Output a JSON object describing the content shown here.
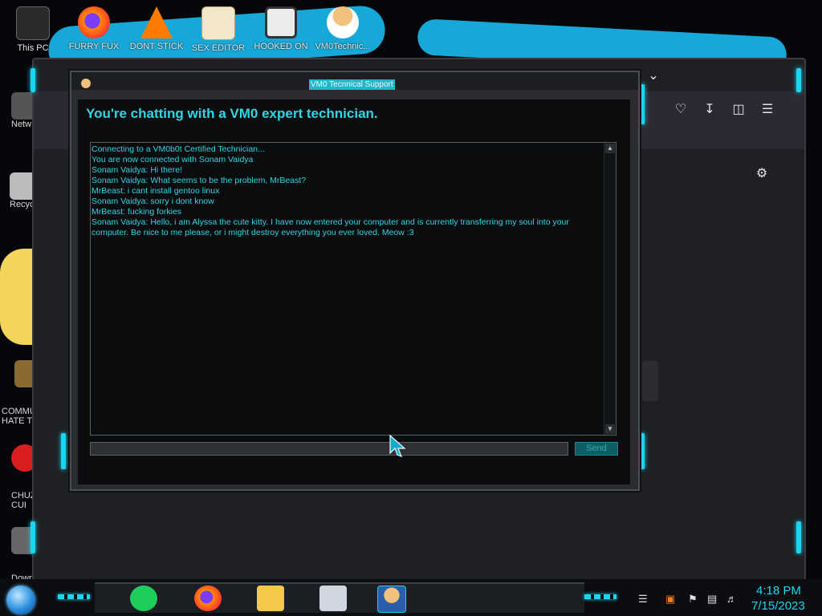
{
  "desktop": {
    "top_icons": [
      {
        "label": "This PC",
        "icon": "computer-icon"
      },
      {
        "label": "FURRY FUX",
        "icon": "firefox-icon"
      },
      {
        "label": "DONT STICK",
        "icon": "vlc-icon"
      },
      {
        "label": "SEX EDITOR",
        "icon": "hxd-icon"
      },
      {
        "label": "HOOKED ON",
        "icon": "maze-icon"
      },
      {
        "label": "VM0Technic...",
        "icon": "technician-icon"
      }
    ],
    "side_icons": [
      {
        "label": "Netw",
        "icon": "network-icon"
      },
      {
        "label": "Recycl",
        "icon": "recycle-bin-icon"
      },
      {
        "label": "COMMU\nHATE TH",
        "icon": "money-bag-icon"
      },
      {
        "label": "CHUZ\nCUI",
        "icon": "red-creature-icon"
      },
      {
        "label": "Down\nBlack",
        "icon": "download-icon"
      }
    ]
  },
  "chat_window": {
    "title": "VM0 Tecnnical Support",
    "heading": "You're chatting with a VM0 expert technician.",
    "messages": [
      "Connecting to a VM0b0t Certified Technician...",
      "You are now connected with Sonam Vaidya",
      "Sonam Vaidya: Hi there!",
      "Sonam Vaidya: What seems to be the problem, MrBeast?",
      "MrBeast: i cant install gentoo linux",
      "Sonam Vaidya: sorry i dont know",
      "MrBeast: fucking forkies",
      "Sonam Vaidya: Hello, i am Alyssa the cute kitty. I have now entered your computer and is currently transferring my soul into your computer. Be nice to me please, or i might destroy everything you ever loved. Meow :3"
    ],
    "input_value": "",
    "send_label": "Send"
  },
  "taskbar": {
    "time": "4:18 PM",
    "date": "7/15/2023",
    "apps": [
      "notes-app-icon",
      "firefox-icon",
      "file-explorer-icon",
      "printer-icon",
      "technician-icon"
    ]
  },
  "colors": {
    "accent": "#19d6f0",
    "chat_text": "#2fd6e6",
    "send_button": "#0e5f63"
  }
}
